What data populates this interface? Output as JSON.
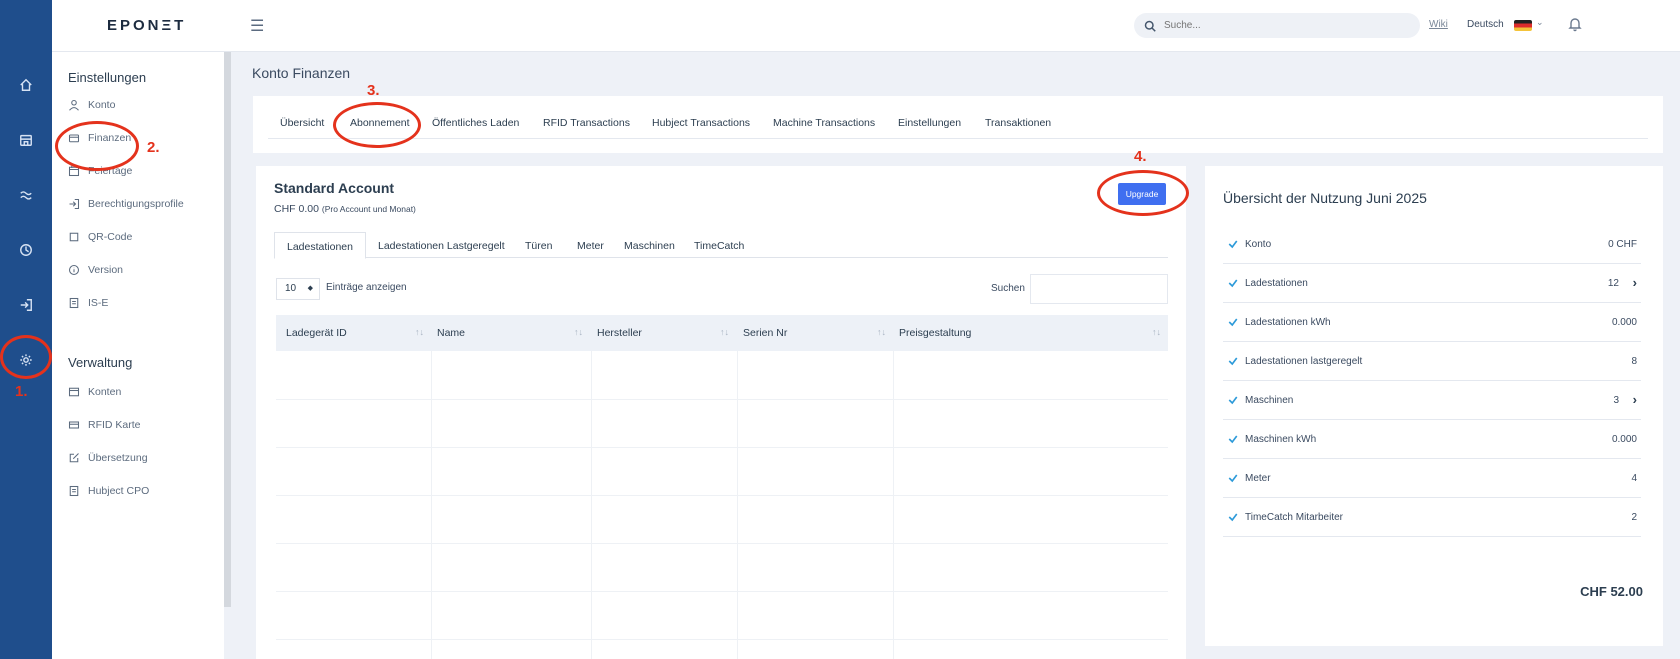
{
  "brand": {
    "logo": "EPONΞT"
  },
  "header": {
    "search_placeholder": "Suche...",
    "wiki": "Wiki",
    "language": "Deutsch"
  },
  "rail": [
    "home-icon",
    "store-icon",
    "waves-icon",
    "clock-icon",
    "login-icon",
    "gear-icon"
  ],
  "sidebar": {
    "settings_title": "Einstellungen",
    "settings_items": [
      {
        "label": "Konto",
        "icon": "user-icon"
      },
      {
        "label": "Finanzen",
        "icon": "wallet-icon"
      },
      {
        "label": "Feiertage",
        "icon": "calendar-icon"
      },
      {
        "label": "Berechtigungsprofile",
        "icon": "enter-icon"
      },
      {
        "label": "QR-Code",
        "icon": "square-icon"
      },
      {
        "label": "Version",
        "icon": "info-icon"
      },
      {
        "label": "IS-E",
        "icon": "document-icon"
      }
    ],
    "admin_title": "Verwaltung",
    "admin_items": [
      {
        "label": "Konten",
        "icon": "window-icon"
      },
      {
        "label": "RFID Karte",
        "icon": "card-icon"
      },
      {
        "label": "Übersetzung",
        "icon": "edit-icon"
      },
      {
        "label": "Hubject CPO",
        "icon": "document-icon"
      }
    ]
  },
  "page": {
    "title": "Konto Finanzen",
    "tabs": [
      "Übersicht",
      "Abonnement",
      "Öffentliches Laden",
      "RFID Transactions",
      "Hubject Transactions",
      "Machine Transactions",
      "Einstellungen",
      "Transaktionen"
    ]
  },
  "account": {
    "title": "Standard Account",
    "price": "CHF 0.00",
    "price_note": "(Pro Account und Monat)",
    "upgrade_label": "Upgrade",
    "tabs": [
      "Ladestationen",
      "Ladestationen Lastgeregelt",
      "Türen",
      "Meter",
      "Maschinen",
      "TimeCatch"
    ],
    "page_length": "10",
    "page_length_label": "Einträge anzeigen",
    "search_label": "Suchen",
    "columns": [
      "Ladegerät ID",
      "Name",
      "Hersteller",
      "Serien Nr",
      "Preisgestaltung"
    ]
  },
  "usage": {
    "title": "Übersicht der Nutzung Juni 2025",
    "rows": [
      {
        "label": "Konto",
        "value": "0 CHF",
        "chevron": false
      },
      {
        "label": "Ladestationen",
        "value": "12",
        "chevron": true
      },
      {
        "label": "Ladestationen kWh",
        "value": "0.000",
        "chevron": false
      },
      {
        "label": "Ladestationen lastgeregelt",
        "value": "8",
        "chevron": false
      },
      {
        "label": "Maschinen",
        "value": "3",
        "chevron": true
      },
      {
        "label": "Maschinen kWh",
        "value": "0.000",
        "chevron": false
      },
      {
        "label": "Meter",
        "value": "4",
        "chevron": false
      },
      {
        "label": "TimeCatch Mitarbeiter",
        "value": "2",
        "chevron": false
      }
    ],
    "total": "CHF 52.00"
  },
  "annotations": [
    "1.",
    "2.",
    "3.",
    "4."
  ],
  "colors": {
    "rail": "#1f4e8c",
    "accent": "#3f6ff0",
    "annotation": "#e4321c",
    "check": "#2c9ad9"
  }
}
